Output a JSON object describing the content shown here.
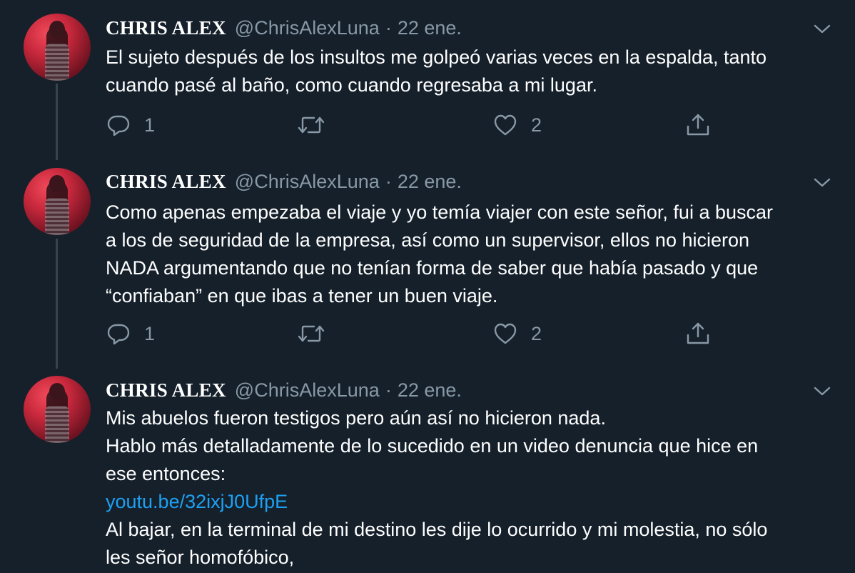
{
  "tweets": [
    {
      "author_name": "CHRIS ALEX",
      "handle": "@ChrisAlexLuna",
      "separator": "·",
      "time": "22 ene.",
      "lines": [
        "El sujeto después de los insultos me golpeó varias veces en la espalda, tanto",
        "cuando pasé al baño, como cuando regresaba a mi lugar."
      ],
      "reply_count": "1",
      "retweet_count": "",
      "like_count": "2"
    },
    {
      "author_name": "CHRIS ALEX",
      "handle": "@ChrisAlexLuna",
      "separator": "·",
      "time": "22 ene.",
      "lines": [
        "Como apenas empezaba el viaje y yo temía viajer con este señor, fui a buscar",
        "a los de seguridad de la empresa, así como un supervisor, ellos no hicieron",
        "NADA argumentando que no tenían forma de saber que había pasado y que",
        "“confiaban” en que ibas a tener un buen viaje."
      ],
      "reply_count": "1",
      "retweet_count": "",
      "like_count": "2"
    },
    {
      "author_name": "CHRIS ALEX",
      "handle": "@ChrisAlexLuna",
      "separator": "·",
      "time": "22 ene.",
      "lines": [
        "Mis abuelos fueron testigos pero aún así no hicieron nada.",
        "Hablo más detalladamente de lo sucedido en un video denuncia que hice en",
        "ese entonces:",
        "youtu.be/32ixjJ0UfpE",
        "Al bajar, en la terminal de mi destino les dije lo ocurrido y mi molestia, no sólo",
        "les señor homofóbico,"
      ]
    }
  ],
  "colors": {
    "background": "#15202b",
    "secondary_text": "#8899a6",
    "link": "#1da1f2",
    "thread_line": "#38444d"
  },
  "icons": {
    "reply": "reply-icon",
    "retweet": "retweet-icon",
    "like": "heart-icon",
    "share": "share-icon",
    "more": "chevron-down-icon"
  }
}
